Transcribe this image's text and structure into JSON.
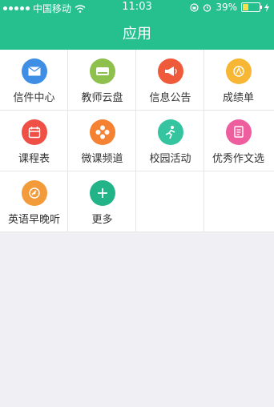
{
  "status_bar": {
    "carrier": "中国移动",
    "time": "11:03",
    "battery": "39%"
  },
  "header": {
    "title": "应用"
  },
  "apps": [
    {
      "label": "信件中心",
      "icon": "envelope-icon",
      "color": "#3f8ee6"
    },
    {
      "label": "教师云盘",
      "icon": "cloud-drive-icon",
      "color": "#8dc04c"
    },
    {
      "label": "信息公告",
      "icon": "megaphone-icon",
      "color": "#ef5b3a"
    },
    {
      "label": "成绩单",
      "icon": "grade-report-icon",
      "color": "#f7b734"
    },
    {
      "label": "课程表",
      "icon": "calendar-icon",
      "color": "#ef4f44"
    },
    {
      "label": "微课频道",
      "icon": "video-channel-icon",
      "color": "#f58232"
    },
    {
      "label": "校园活动",
      "icon": "running-person-icon",
      "color": "#34c4a0"
    },
    {
      "label": "优秀作文选",
      "icon": "document-icon",
      "color": "#ee5e9f"
    },
    {
      "label": "英语早晚听",
      "icon": "audio-disc-icon",
      "color": "#f39a3b"
    },
    {
      "label": "更多",
      "icon": "plus-icon",
      "color": "#22b389"
    }
  ]
}
